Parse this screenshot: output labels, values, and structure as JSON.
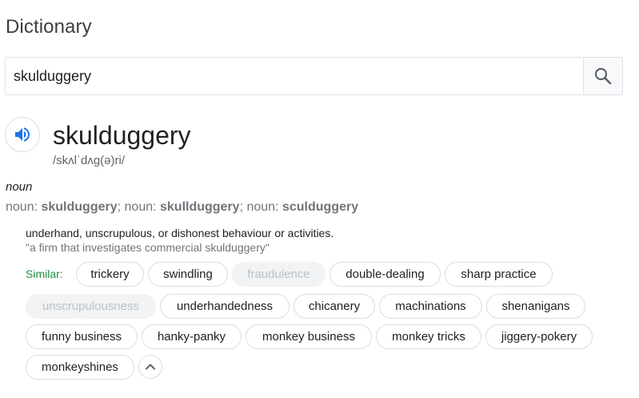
{
  "header": {
    "title": "Dictionary"
  },
  "search": {
    "value": "skulduggery"
  },
  "entry": {
    "word": "skulduggery",
    "phonetic": "/skʌlˈdʌɡ(ə)ri/",
    "part_of_speech": "noun",
    "forms": [
      {
        "prefix": "noun: ",
        "word": "skulduggery",
        "sep": "; "
      },
      {
        "prefix": "noun: ",
        "word": "skullduggery",
        "sep": "; "
      },
      {
        "prefix": "noun: ",
        "word": "sculduggery",
        "sep": ""
      }
    ],
    "definition": "underhand, unscrupulous, or dishonest behaviour or activities.",
    "example": "\"a firm that investigates commercial skulduggery\"",
    "similar_label": "Similar:",
    "similar": [
      {
        "label": "trickery",
        "enabled": true
      },
      {
        "label": "swindling",
        "enabled": true
      },
      {
        "label": "fraudulence",
        "enabled": false
      },
      {
        "label": "double-dealing",
        "enabled": true
      },
      {
        "label": "sharp practice",
        "enabled": true
      },
      {
        "label": "unscrupulousness",
        "enabled": false
      },
      {
        "label": "underhandedness",
        "enabled": true
      },
      {
        "label": "chicanery",
        "enabled": true
      },
      {
        "label": "machinations",
        "enabled": true
      },
      {
        "label": "shenanigans",
        "enabled": true
      },
      {
        "label": "funny business",
        "enabled": true
      },
      {
        "label": "hanky-panky",
        "enabled": true
      },
      {
        "label": "monkey business",
        "enabled": true
      },
      {
        "label": "monkey tricks",
        "enabled": true
      },
      {
        "label": "jiggery-pokery",
        "enabled": true
      },
      {
        "label": "monkeyshines",
        "enabled": true
      }
    ]
  },
  "icons": {
    "search": "search-icon",
    "speaker": "speaker-icon",
    "collapse": "chevron-up-icon"
  },
  "colors": {
    "accent_blue": "#1a73e8",
    "similar_green": "#1e8e3e",
    "disabled_text": "#bdc1c6"
  }
}
